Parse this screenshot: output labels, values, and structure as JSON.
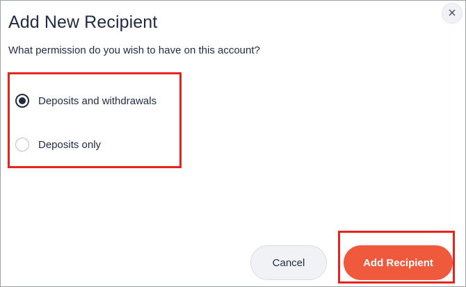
{
  "dialog": {
    "title": "Add New Recipient",
    "subtitle": "What permission do you wish to have on this account?",
    "close_icon_glyph": "×"
  },
  "permissions": {
    "options": [
      {
        "label": "Deposits and withdrawals",
        "selected": true
      },
      {
        "label": "Deposits only",
        "selected": false
      }
    ]
  },
  "actions": {
    "cancel_label": "Cancel",
    "submit_label": "Add Recipient"
  },
  "colors": {
    "primary_text": "#1f2a44",
    "accent": "#f05a3c",
    "annotation": "#e8231b"
  }
}
